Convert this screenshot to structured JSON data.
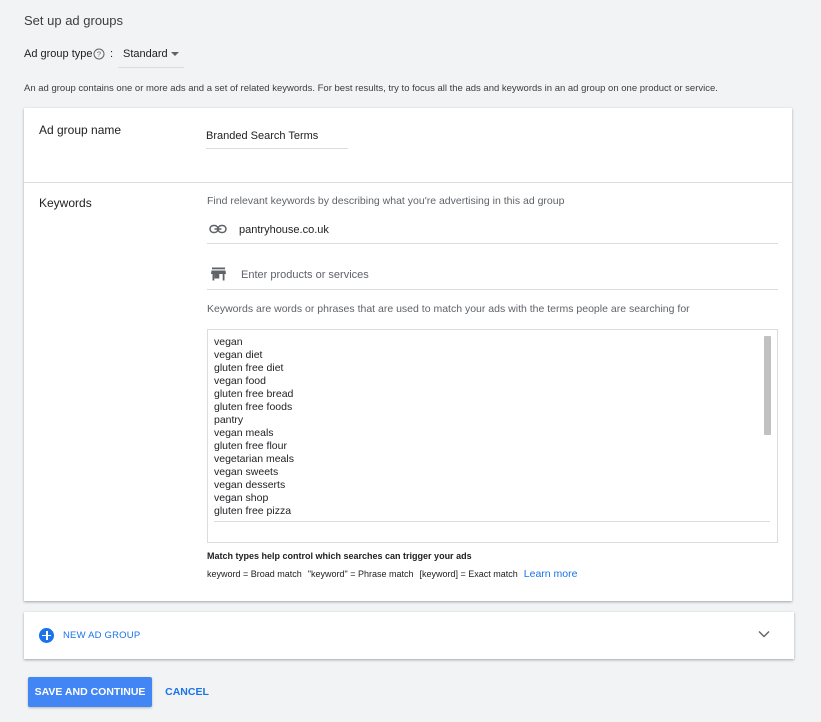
{
  "page": {
    "title": "Set up ad groups",
    "ad_group_type_label": "Ad group type",
    "colon": ":",
    "ad_group_type_value": "Standard",
    "description": "An ad group contains one or more ads and a set of related keywords. For best results, try to focus all the ads and keywords in an ad group on one product or service."
  },
  "ad_group": {
    "name_label": "Ad group name",
    "name_value": "Branded Search Terms"
  },
  "keywords": {
    "label": "Keywords",
    "find_hint": "Find relevant keywords by describing what you're advertising in this ad group",
    "url": "pantryhouse.co.uk",
    "products_placeholder": "Enter products or services",
    "definition_hint": "Keywords are words or phrases that are used to match your ads with the terms people are searching for",
    "items": [
      "vegan",
      "vegan diet",
      "gluten free diet",
      "vegan food",
      "gluten free bread",
      "gluten free foods",
      "pantry",
      "vegan meals",
      "gluten free flour",
      "vegetarian meals",
      "vegan sweets",
      "vegan desserts",
      "vegan shop",
      "gluten free pizza"
    ],
    "match_title": "Match types help control which searches can trigger your ads",
    "match_broad": "keyword = Broad match",
    "match_phrase": "\"keyword\" = Phrase match",
    "match_exact": "[keyword] = Exact match",
    "learn_more": "Learn more"
  },
  "new_ad_group": {
    "label": "NEW AD GROUP"
  },
  "actions": {
    "save": "SAVE AND CONTINUE",
    "cancel": "CANCEL"
  },
  "colors": {
    "accent": "#1a73e8",
    "primary_button": "#4285f4",
    "background": "#f1f3f4"
  }
}
